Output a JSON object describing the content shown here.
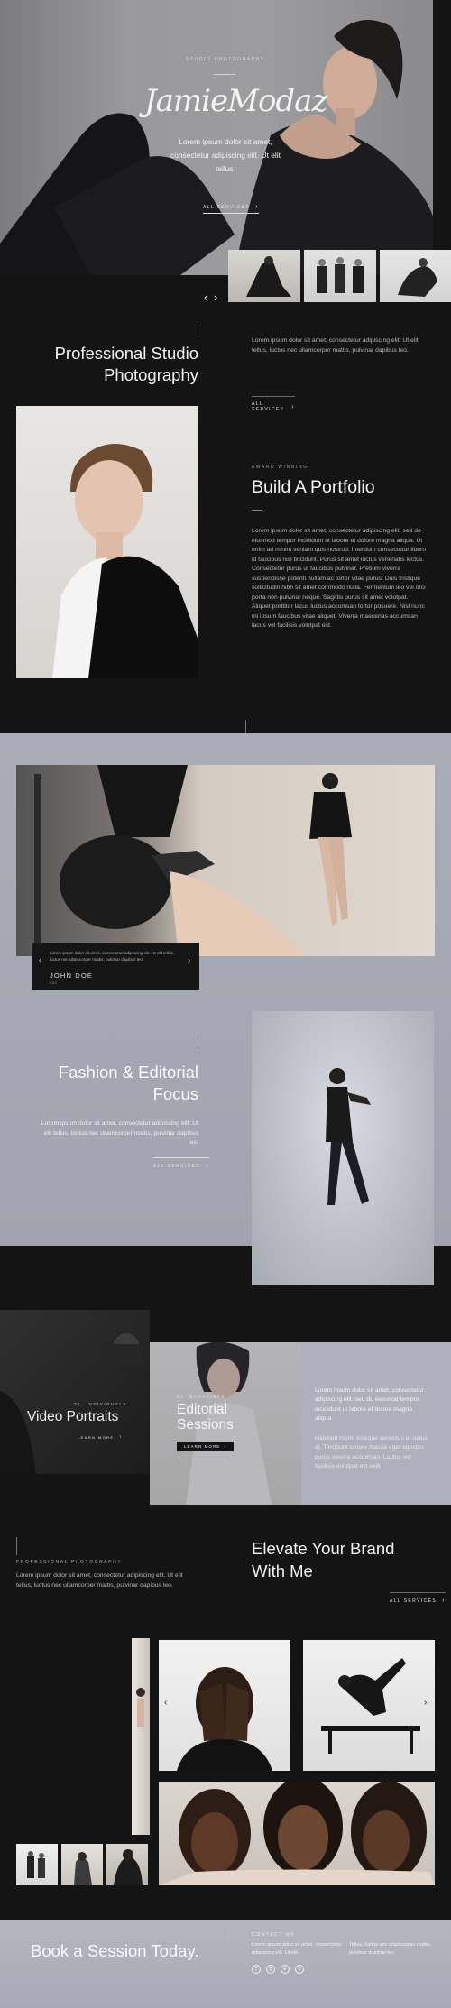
{
  "colors": {
    "dark": "#141414",
    "grey_band": "#a3a5b0",
    "footer": "#b0b2bc",
    "text_light": "#f2f2f2"
  },
  "hero": {
    "eyebrow": "STUDIO PHOTOGRAPHY",
    "signature": "JamieModaz",
    "body": "Lorem ipsum dolor sit amet, consectetur adipiscing elit. Ut elit tellus.",
    "link": "ALL SERVICES",
    "prev": "‹",
    "next": "›"
  },
  "studio": {
    "title_line1": "Professional Studio",
    "title_line2": "Photography",
    "body": "Lorem ipsum dolor sit amet, consectetur adipiscing elit. Ut elit tellus, luctus nec ullamcorper mattis, pulvinar dapibus leo.",
    "link": "ALL SERVICES"
  },
  "portfolio": {
    "eyebrow": "AWARD WINNING",
    "title": "Build A Portfolio",
    "body": "Lorem ipsum dolor sit amet, consectetur adipiscing elit, sed do eiusmod tempor incididunt ut labore et dolore magna aliqua. Ut enim ad minim veniam quis nostrud. Interdum consectetur libero id faucibus nisl tincidunt. Purus sit amet luctus venenatis lectus. Consectetur purus ut faucibus pulvinar. Pretium viverra suspendisse potenti nullam ac tortor vitae purus. Duis tristique sollicitudin nibh sit amet commodo nulla. Fermentum leo vel orci porta non pulvinar neque. Sagittis purus sit amet volutpat. Aliquet porttitor lacus luctus accumsan tortor posuere. Nisl nunc mi ipsum faucibus vitae aliquet. Viverra maecenas accumsan lacus vel facilisis volutpat est."
  },
  "testimonial": {
    "quote": "Lorem ipsum dolor sit amet, consectetur adipiscing elit. Ut elit tellus, luctus nec ullamcorper mattis, pulvinar dapibus leo.",
    "name": "JOHN DOE",
    "role": "CEO",
    "prev": "‹",
    "next": "›"
  },
  "fashion": {
    "title_line1": "Fashion & Editorial",
    "title_line2": "Focus",
    "body": "Lorem ipsum dolor sit amet, consectetur adipiscing elit. Ut elit tellus, luctus nec ullamcorper mattis, pulvinar dapibus leo.",
    "link": "ALL SERVICES"
  },
  "video": {
    "eyebrow": "01. INDIVIDUALS",
    "title": "Video Portraits",
    "link": "LEARN MORE"
  },
  "editorial": {
    "eyebrow": "02. MAGAZINES",
    "title_line1": "Editorial",
    "title_line2": "Sessions",
    "button": "LEARN MORE",
    "body1": "Lorem ipsum dolor sit amet, consectetur adipiscing elit, sed do eiusmod tempor incididunt ut labore et dolore magna aliqua.",
    "body2": "Habitant morbi tristique senectus et netus et. Tincidunt ornare massa eget egestas purus viverra accumsan. Luctus vel facilisis volutpat est velit."
  },
  "elevate": {
    "eyebrow": "PROFESSIONAL PHOTOGRAPHY",
    "body": "Lorem ipsum dolor sit amet, consectetur adipiscing elit. Ut elit tellus, luctus nec ullamcorper mattis, pulvinar dapibus leo.",
    "title_line1": "Elevate Your Brand",
    "title_line2": "With Me",
    "link": "ALL SERVICES",
    "prev": "‹",
    "next": "›"
  },
  "footer": {
    "cta": "Book a Session Today.",
    "eyebrow": "CONTACT US",
    "col1": "Lorem ipsum dolor sit amet, consectetur adipiscing elit. Ut elit.",
    "col2": "Tellus, luctus nec ullamcorper mattis, pulvinar dapibus leo."
  },
  "icons": [
    "facebook-icon",
    "instagram-icon",
    "youtube-icon",
    "pinterest-icon"
  ]
}
